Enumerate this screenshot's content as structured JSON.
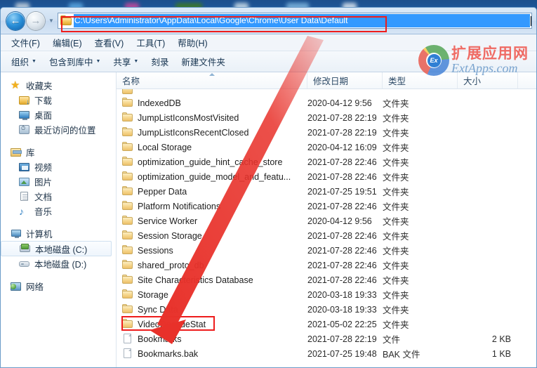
{
  "window": {
    "address": {
      "path": "C:\\Users\\Administrator\\AppData\\Local\\Google\\Chrome\\User Data\\Default",
      "back_glyph": "←",
      "forward_glyph": "→",
      "history_chevron": "▼"
    },
    "menu": [
      {
        "label": "文件(F)"
      },
      {
        "label": "编辑(E)"
      },
      {
        "label": "查看(V)"
      },
      {
        "label": "工具(T)"
      },
      {
        "label": "帮助(H)"
      }
    ],
    "toolbar": [
      {
        "label": "组织",
        "caret": "▼"
      },
      {
        "label": "包含到库中",
        "caret": "▼"
      },
      {
        "label": "共享",
        "caret": "▼"
      },
      {
        "label": "刻录",
        "caret": ""
      },
      {
        "label": "新建文件夹",
        "caret": ""
      }
    ]
  },
  "watermark": {
    "cn": "扩展应用网",
    "en": "ExtApps.com",
    "logo_text": "Ex"
  },
  "sidebar": {
    "groups": [
      {
        "header": {
          "label": "收藏夹",
          "icon": "star-icon"
        },
        "items": [
          {
            "label": "下载",
            "icon": "downloads-folder-icon"
          },
          {
            "label": "桌面",
            "icon": "desktop-icon"
          },
          {
            "label": "最近访问的位置",
            "icon": "recent-places-icon"
          }
        ]
      },
      {
        "header": {
          "label": "库",
          "icon": "library-icon"
        },
        "items": [
          {
            "label": "视频",
            "icon": "video-icon"
          },
          {
            "label": "图片",
            "icon": "pictures-icon"
          },
          {
            "label": "文档",
            "icon": "documents-icon"
          },
          {
            "label": "音乐",
            "icon": "music-icon"
          }
        ]
      },
      {
        "header": {
          "label": "计算机",
          "icon": "computer-icon"
        },
        "items": [
          {
            "label": "本地磁盘 (C:)",
            "icon": "local-disk-c-icon",
            "selected": true
          },
          {
            "label": "本地磁盘 (D:)",
            "icon": "local-disk-d-icon",
            "selected": false
          }
        ]
      },
      {
        "header": {
          "label": "网络",
          "icon": "network-icon"
        },
        "items": []
      }
    ]
  },
  "file_list": {
    "columns": [
      {
        "key": "name",
        "label": "名称",
        "sorted": true
      },
      {
        "key": "date",
        "label": "修改日期",
        "sorted": false
      },
      {
        "key": "type",
        "label": "类型",
        "sorted": false
      },
      {
        "key": "size",
        "label": "大小",
        "sorted": false
      }
    ],
    "rows": [
      {
        "name": "",
        "date": "",
        "type": "",
        "size": "",
        "icon": "folder-icon",
        "clipped": true
      },
      {
        "name": "IndexedDB",
        "date": "2020-04-12 9:56",
        "type": "文件夹",
        "size": "",
        "icon": "folder-icon"
      },
      {
        "name": "JumpListIconsMostVisited",
        "date": "2021-07-28 22:19",
        "type": "文件夹",
        "size": "",
        "icon": "folder-icon"
      },
      {
        "name": "JumpListIconsRecentClosed",
        "date": "2021-07-28 22:19",
        "type": "文件夹",
        "size": "",
        "icon": "folder-icon"
      },
      {
        "name": "Local Storage",
        "date": "2020-04-12 16:09",
        "type": "文件夹",
        "size": "",
        "icon": "folder-icon"
      },
      {
        "name": "optimization_guide_hint_cache_store",
        "date": "2021-07-28 22:46",
        "type": "文件夹",
        "size": "",
        "icon": "folder-icon"
      },
      {
        "name": "optimization_guide_model_and_featu...",
        "date": "2021-07-28 22:46",
        "type": "文件夹",
        "size": "",
        "icon": "folder-icon"
      },
      {
        "name": "Pepper Data",
        "date": "2021-07-25 19:51",
        "type": "文件夹",
        "size": "",
        "icon": "folder-icon"
      },
      {
        "name": "Platform Notifications",
        "date": "2021-07-28 22:46",
        "type": "文件夹",
        "size": "",
        "icon": "folder-icon"
      },
      {
        "name": "Service Worker",
        "date": "2020-04-12 9:56",
        "type": "文件夹",
        "size": "",
        "icon": "folder-icon"
      },
      {
        "name": "Session Storage",
        "date": "2021-07-28 22:46",
        "type": "文件夹",
        "size": "",
        "icon": "folder-icon"
      },
      {
        "name": "Sessions",
        "date": "2021-07-28 22:46",
        "type": "文件夹",
        "size": "",
        "icon": "folder-icon"
      },
      {
        "name": "shared_proto_db",
        "date": "2021-07-28 22:46",
        "type": "文件夹",
        "size": "",
        "icon": "folder-icon"
      },
      {
        "name": "Site Characteristics Database",
        "date": "2021-07-28 22:46",
        "type": "文件夹",
        "size": "",
        "icon": "folder-icon"
      },
      {
        "name": "Storage",
        "date": "2020-03-18 19:33",
        "type": "文件夹",
        "size": "",
        "icon": "folder-icon"
      },
      {
        "name": "Sync Data",
        "date": "2020-03-18 19:33",
        "type": "文件夹",
        "size": "",
        "icon": "folder-icon"
      },
      {
        "name": "VideoDecodeStat",
        "date": "2021-05-02 22:25",
        "type": "文件夹",
        "size": "",
        "icon": "folder-icon"
      },
      {
        "name": "Bookmarks",
        "date": "2021-07-28 22:19",
        "type": "文件",
        "size": "2 KB",
        "icon": "file-icon",
        "highlighted": true
      },
      {
        "name": "Bookmarks.bak",
        "date": "2021-07-25 19:48",
        "type": "BAK 文件",
        "size": "1 KB",
        "icon": "file-icon"
      }
    ]
  },
  "annotations": {
    "highlight_color": "#ee1c1c",
    "arrow_color": "#e8312a",
    "address_box_target": "address-bar",
    "row_box_target": "Bookmarks"
  }
}
